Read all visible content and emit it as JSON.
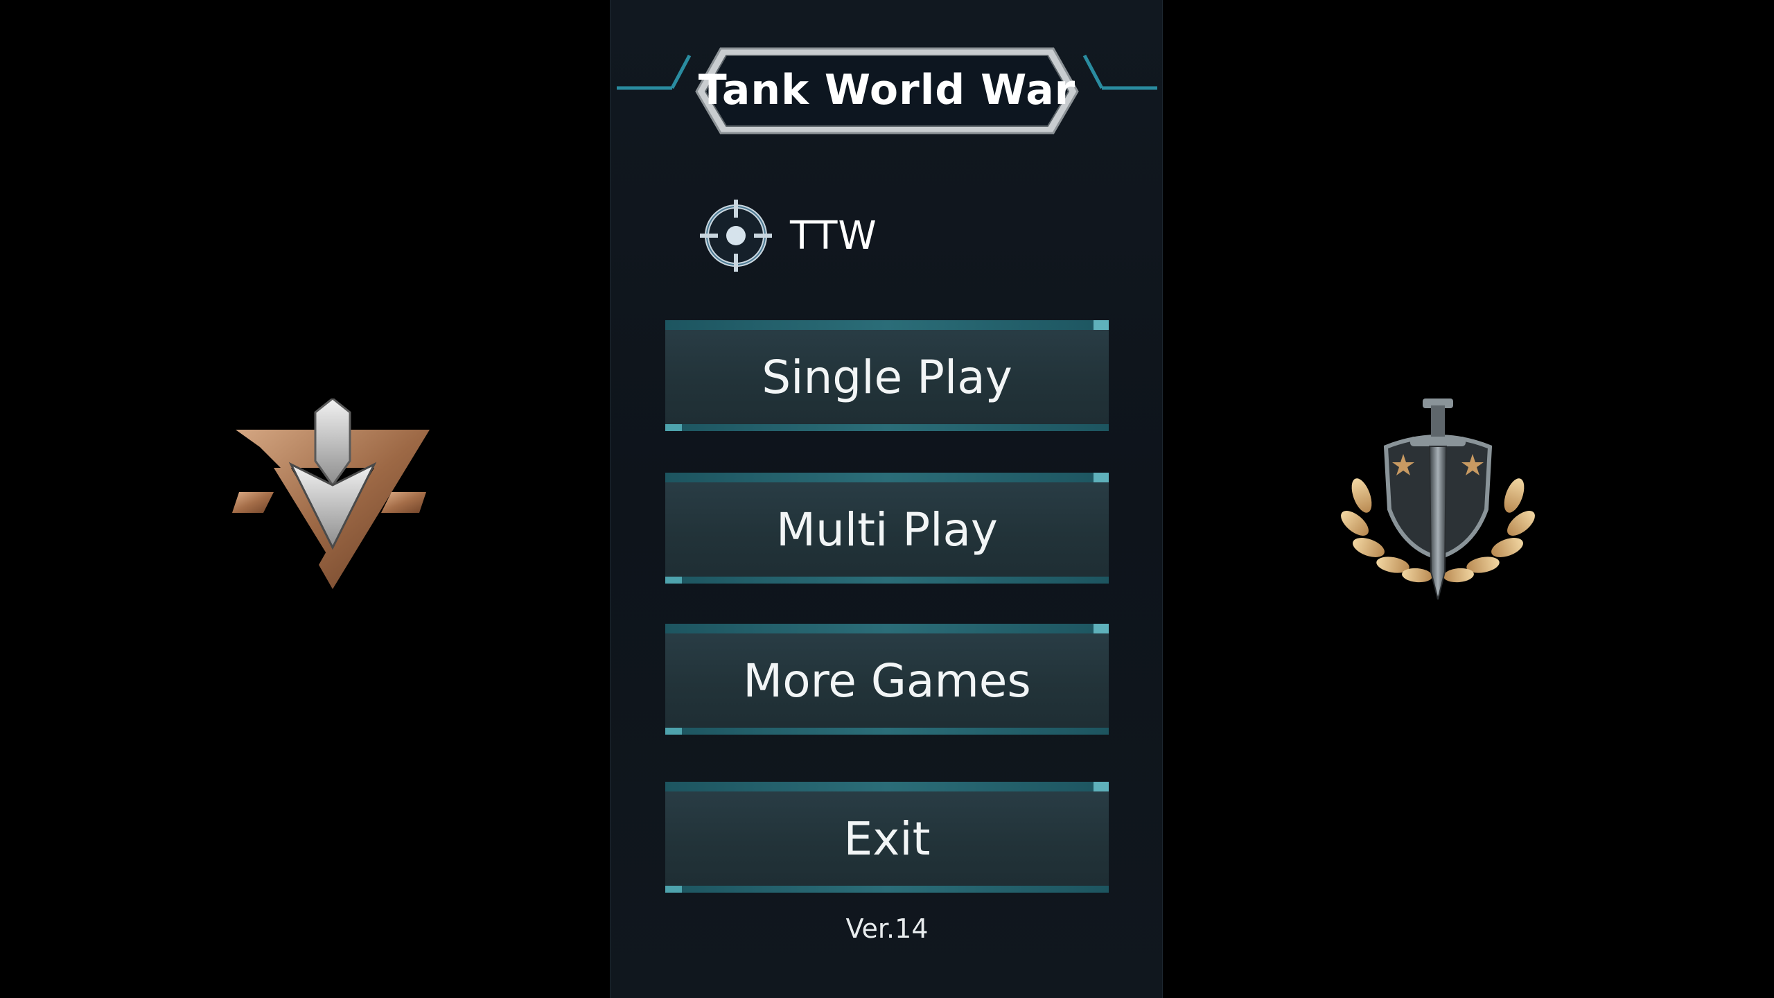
{
  "title": "Tank World War",
  "profile": {
    "name": "TTW",
    "icon": "crosshair-icon"
  },
  "menu": [
    {
      "label": "Single Play"
    },
    {
      "label": "Multi Play"
    },
    {
      "label": "More Games"
    },
    {
      "label": "Exit"
    }
  ],
  "version": "Ver.14",
  "emblems": {
    "left": "rank-chevron-emblem",
    "right": "sword-shield-laurel-emblem"
  },
  "colors": {
    "background": "#000000",
    "panel": "#111820",
    "button": "#243840",
    "accent": "#5fb1bb",
    "text": "#ffffff",
    "bronze": "#b07a55"
  }
}
